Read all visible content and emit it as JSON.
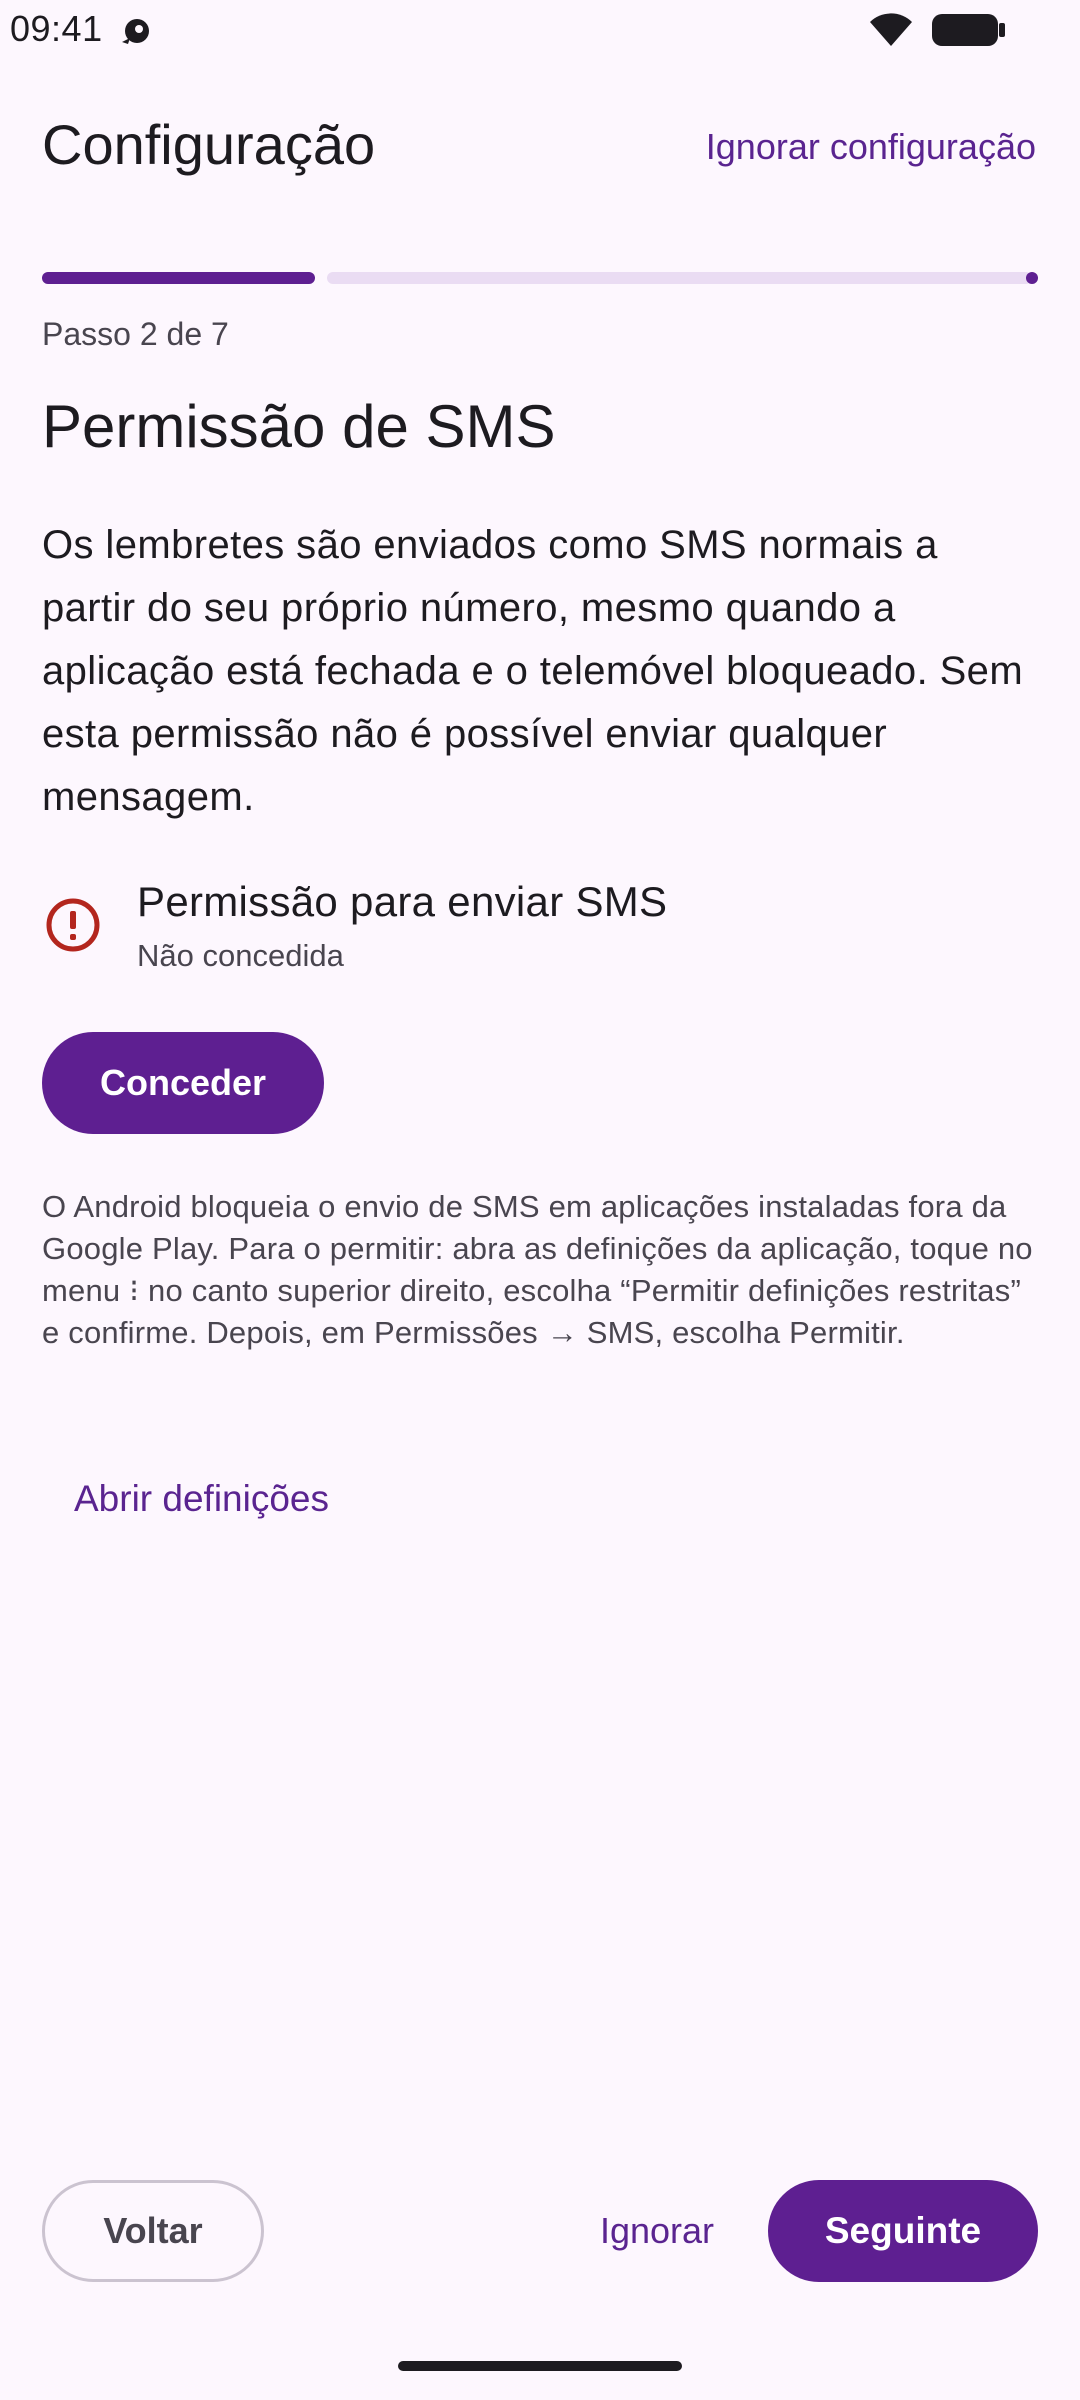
{
  "status_bar": {
    "time": "09:41",
    "icons": [
      "sync-icon",
      "wifi-icon",
      "battery-icon"
    ]
  },
  "header": {
    "title": "Configuração",
    "skip_setup": "Ignorar configuração"
  },
  "progress": {
    "current_step": 2,
    "total_steps": 7,
    "step_label": "Passo 2 de 7",
    "accent_color": "#5e1f91",
    "track_color": "#eadcf3"
  },
  "content": {
    "heading": "Permissão de SMS",
    "description": "Os lembretes são enviados como SMS normais a partir do seu próprio número, mesmo quando a aplicação está fechada e o telemóvel bloqueado. Sem esta permissão não é possível enviar qualquer mensagem.",
    "permission": {
      "icon": "error-icon",
      "title": "Permissão para enviar SMS",
      "status": "Não concedida",
      "status_color": "#b3261e"
    },
    "grant_button": "Conceder",
    "help_text": "O Android bloqueia o envio de SMS em aplicações instaladas fora da Google Play. Para o permitir: abra as definições da aplicação, toque no menu ⁝ no canto superior direito, escolha “Permitir definições restritas” e confirme. Depois, em Permissões → SMS, escolha Permitir.",
    "open_settings": "Abrir definições"
  },
  "footer": {
    "back": "Voltar",
    "skip": "Ignorar",
    "next": "Seguinte"
  }
}
